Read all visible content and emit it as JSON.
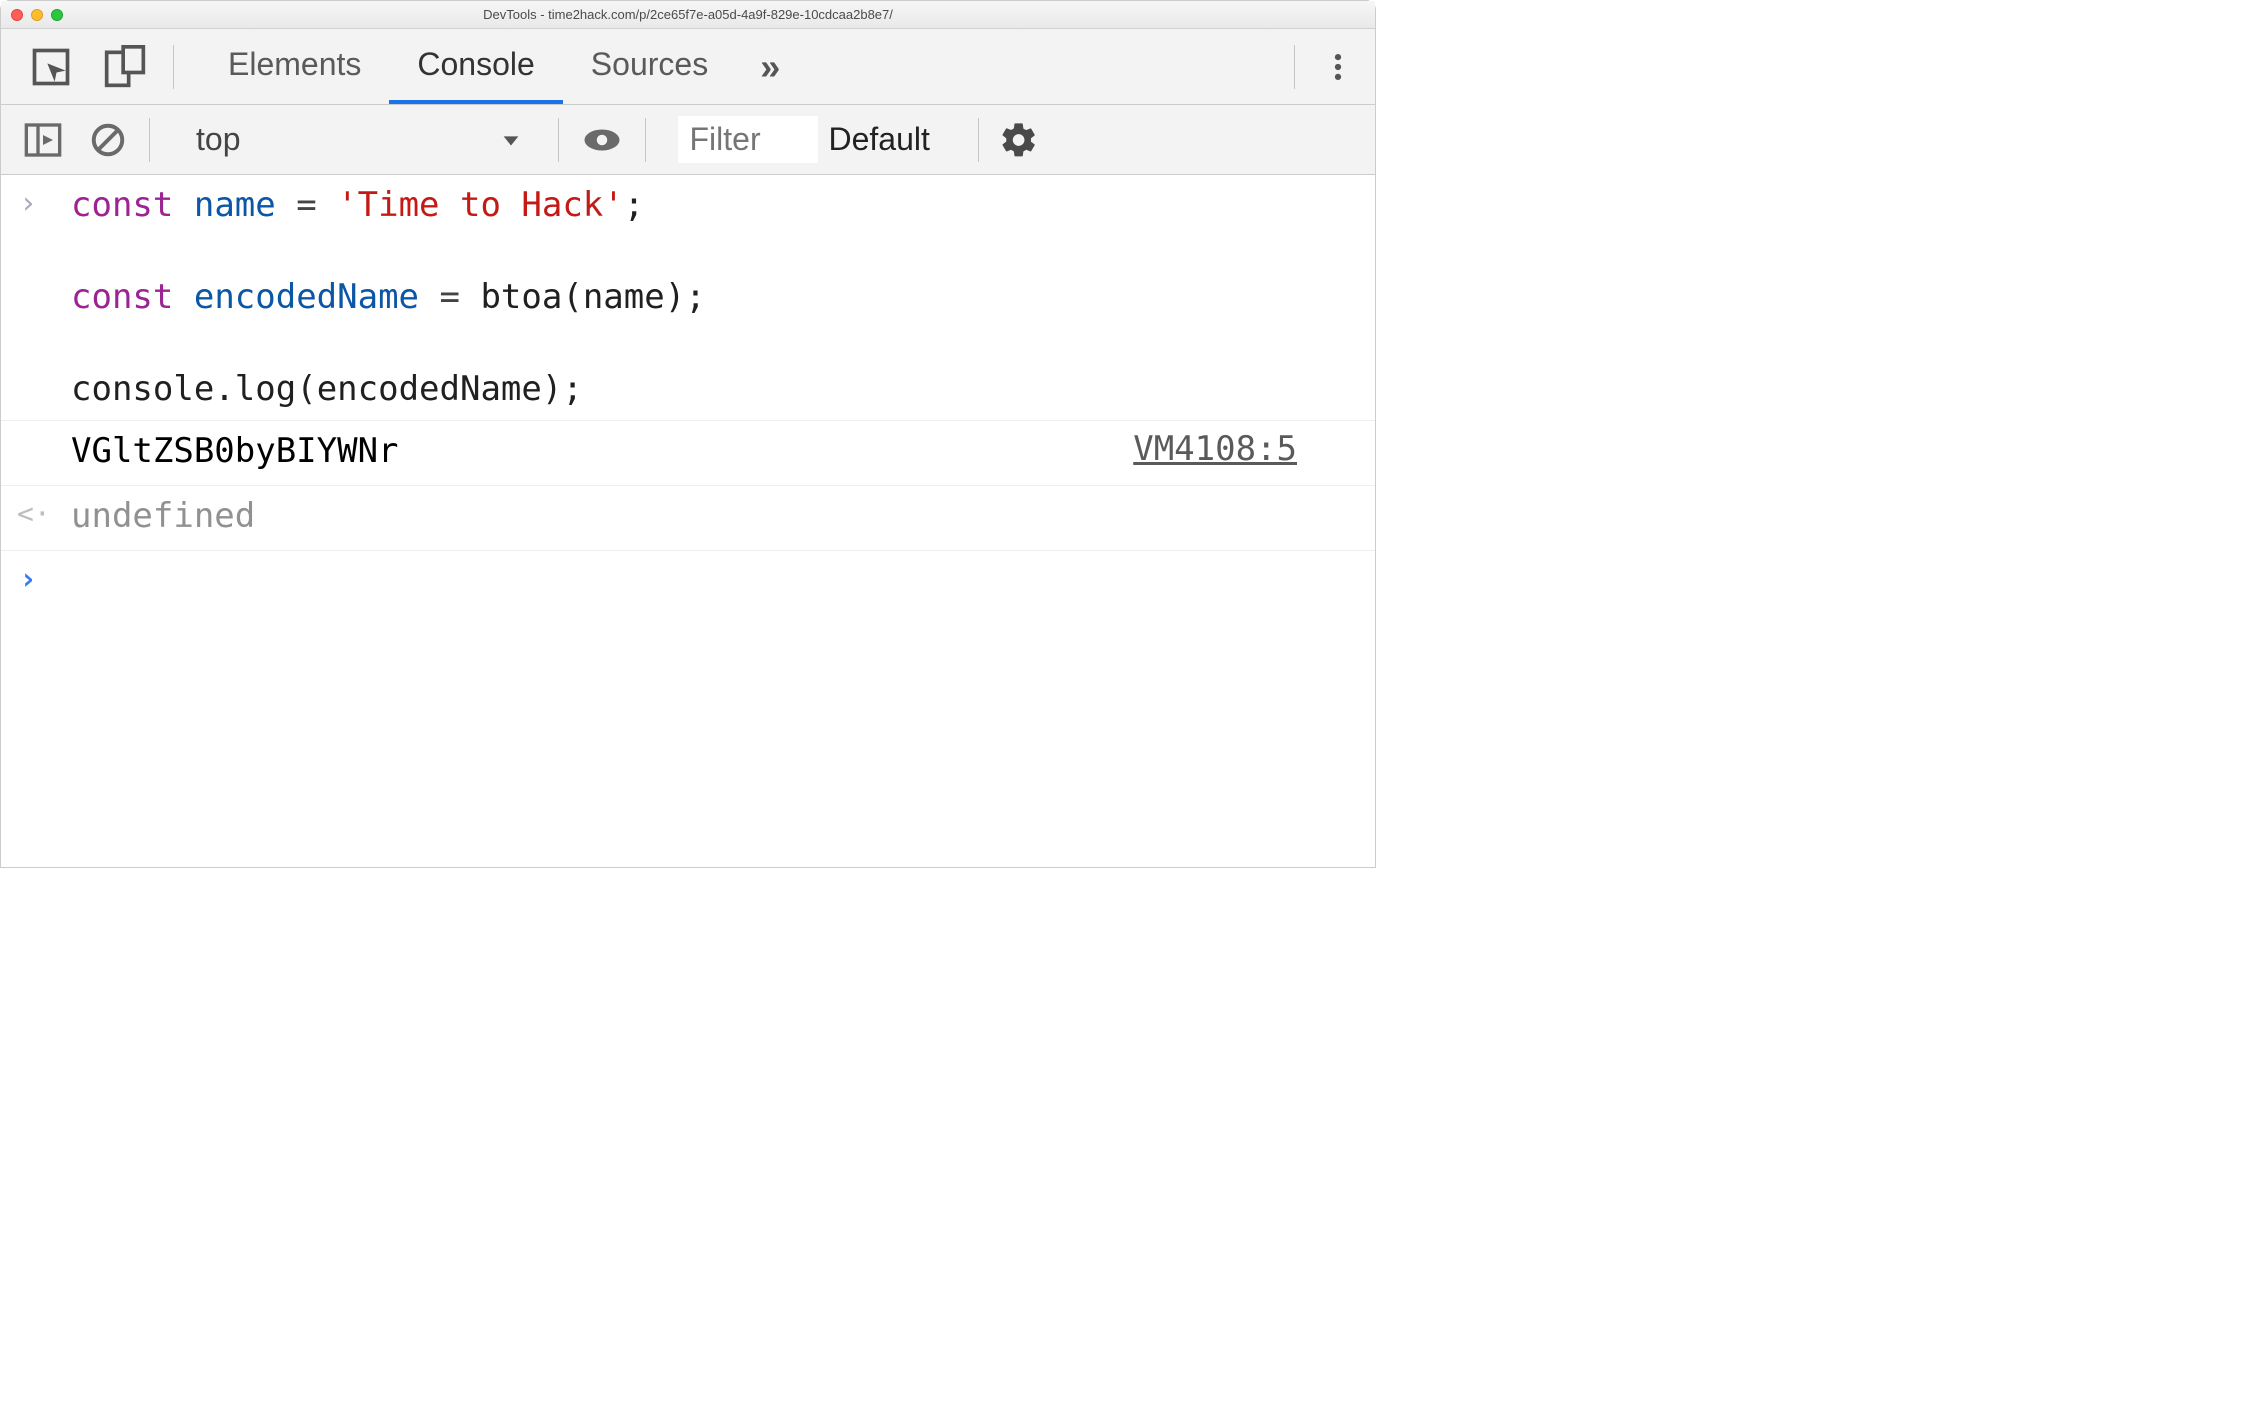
{
  "window": {
    "title": "DevTools - time2hack.com/p/2ce65f7e-a05d-4a9f-829e-10cdcaa2b8e7/"
  },
  "tabs": {
    "elements": "Elements",
    "console": "Console",
    "sources": "Sources",
    "active": "Console"
  },
  "console_toolbar": {
    "context": "top",
    "filter_placeholder": "Filter",
    "levels_label": "Default"
  },
  "code": {
    "kw1": "const",
    "var1": "name",
    "eq": " = ",
    "str1": "'Time to Hack'",
    "semi": ";",
    "kw2": "const",
    "var2": "encodedName",
    "fn_btoa": "btoa",
    "open_paren": "(",
    "close_paren": ")",
    "arg_name": "name",
    "console_obj": "console",
    "dot": ".",
    "log_fn": "log",
    "arg_encoded": "encodedName"
  },
  "output": {
    "value": "VGltZSB0byBIYWNr",
    "source": "VM4108:5"
  },
  "return": {
    "value": "undefined"
  }
}
